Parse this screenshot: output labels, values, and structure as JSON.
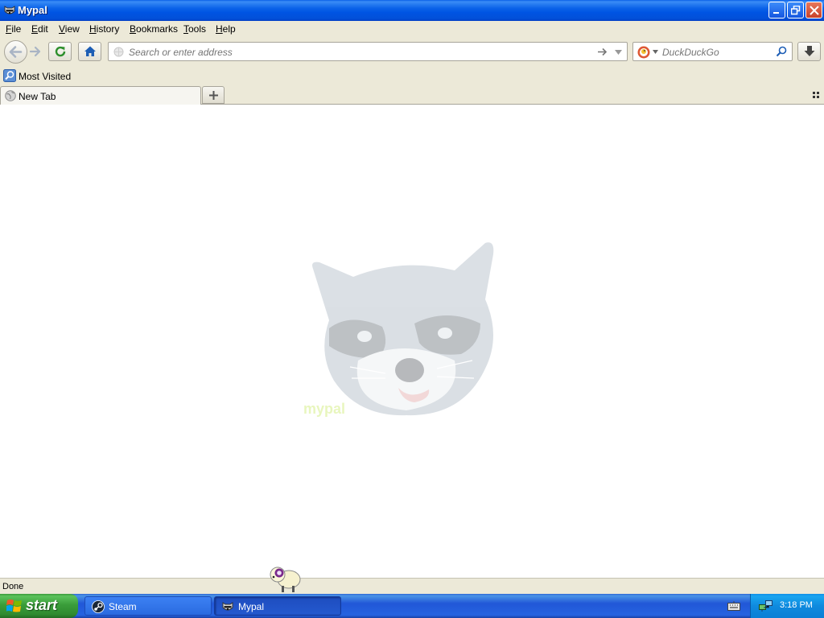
{
  "window": {
    "title": "Mypal",
    "icon": "raccoon-icon"
  },
  "menu": {
    "items": [
      {
        "label": "File",
        "accel": "F",
        "rest": "ile"
      },
      {
        "label": "Edit",
        "accel": "E",
        "rest": "dit"
      },
      {
        "label": "View",
        "accel": "V",
        "rest": "iew"
      },
      {
        "label": "History",
        "accel": "H",
        "rest": "istory"
      },
      {
        "label": "Bookmarks",
        "accel": "B",
        "rest": "ookmarks"
      },
      {
        "label": "Tools",
        "accel": "T",
        "rest": "ools"
      },
      {
        "label": "Help",
        "accel": "H",
        "rest": "elp"
      }
    ]
  },
  "toolbar": {
    "address_placeholder": "Search or enter address",
    "address_value": "",
    "search_placeholder": "DuckDuckGo",
    "search_engine_icon": "duckduckgo-icon"
  },
  "bookmarks": {
    "items": [
      {
        "label": "Most Visited",
        "icon": "most-visited-icon"
      }
    ]
  },
  "tabs": [
    {
      "label": "New Tab",
      "active": true
    }
  ],
  "content": {
    "watermark": "raccoon-logo"
  },
  "status": {
    "text": "Done"
  },
  "taskbar": {
    "start_label": "start",
    "tasks": [
      {
        "label": "Steam",
        "icon": "steam-icon"
      },
      {
        "label": "Mypal",
        "icon": "raccoon-icon",
        "active": true
      }
    ],
    "clock": "3:18 PM"
  },
  "colors": {
    "titlebar": "#0054e3",
    "taskbar": "#2663e0",
    "start": "#3a9d3a",
    "chrome": "#ece9d8"
  }
}
